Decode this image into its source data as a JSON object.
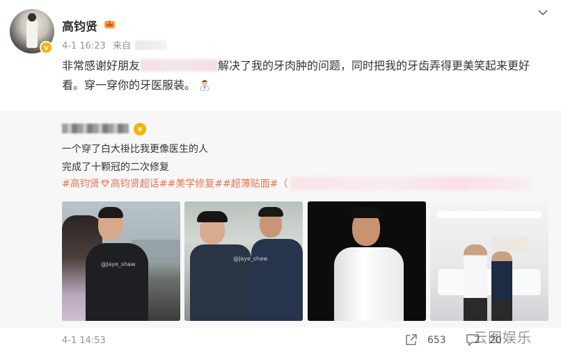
{
  "post": {
    "username": "高钧贤",
    "time": "4-1 16:23",
    "source_prefix": "来自",
    "text_before": "非常感谢好朋友",
    "text_after": "解决了我的牙肉肿的问题，同时把我的牙齿弄得更美笑起来更好看。穿一穿你的牙医服装。",
    "badge_icon": "crown-badge-icon",
    "emoji_icon": "doctor-emoji-icon"
  },
  "repost": {
    "line1": "一个穿了白大褂比我更像医生的人",
    "line2": "完成了十颗冠的二次修复",
    "tags": [
      "#高钧贤",
      "高钧贤超话#",
      "#美学修复#",
      "#超薄贴面#"
    ],
    "tag_trailing": "（",
    "photo_watermark": "@Jaye_shaw"
  },
  "footer": {
    "time": "4-1 14:53",
    "share_count": "653",
    "comment_count": "20",
    "site_watermark": "云图娱乐"
  },
  "colors": {
    "tag": "#eb7350",
    "verified": "#f6b400",
    "meta": "#939393"
  }
}
